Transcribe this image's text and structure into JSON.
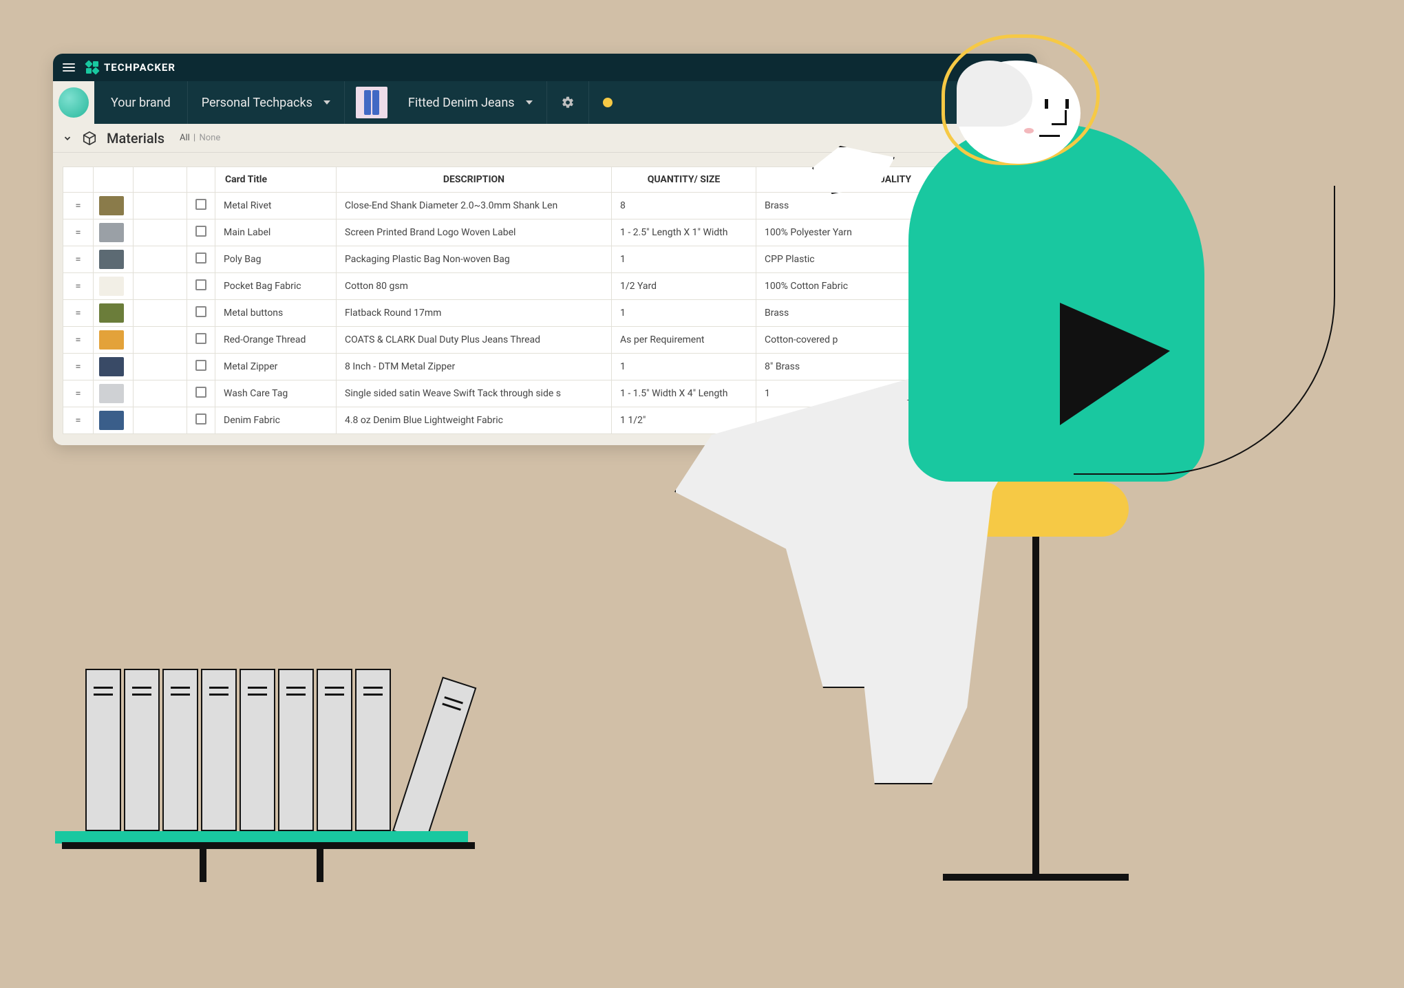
{
  "app": {
    "name": "TECHPACKER"
  },
  "nav": {
    "brand": "Your brand",
    "techpacks_dropdown": "Personal Techpacks",
    "product_dropdown": "Fitted Denim Jeans"
  },
  "section": {
    "title": "Materials",
    "filter_all": "All",
    "filter_none": "None"
  },
  "table": {
    "headers": {
      "card_title": "Card Title",
      "description": "DESCRIPTION",
      "quantity": "QUANTITY/ SIZE",
      "quality": "QUALITY"
    },
    "rows": [
      {
        "swatch": "#8a7b4a",
        "title": "Metal Rivet",
        "description": "Close-End  Shank Diameter 2.0~3.0mm Shank Len",
        "quantity": "8",
        "quality": "Brass"
      },
      {
        "swatch": "#9aa0a6",
        "title": "Main Label",
        "description": "Screen Printed Brand Logo Woven Label",
        "quantity": "1 - 2.5\" Length X 1\" Width",
        "quality": "100% Polyester Yarn"
      },
      {
        "swatch": "#5c6a73",
        "title": "Poly Bag",
        "description": "Packaging Plastic Bag Non-woven Bag",
        "quantity": "1",
        "quality": "CPP Plastic"
      },
      {
        "swatch": "#f2efe6",
        "title": "Pocket Bag Fabric",
        "description": "Cotton 80 gsm",
        "quantity": "1/2 Yard",
        "quality": "100% Cotton Fabric"
      },
      {
        "swatch": "#6b7d3a",
        "title": "Metal buttons",
        "description": "Flatback Round 17mm",
        "quantity": "1",
        "quality": "Brass"
      },
      {
        "swatch": "#e3a23a",
        "title": "Red-Orange Thread",
        "description": "COATS & CLARK Dual Duty Plus Jeans Thread",
        "quantity": "As per Requirement",
        "quality": "Cotton-covered p"
      },
      {
        "swatch": "#394a66",
        "title": "Metal Zipper",
        "description": " 8 Inch - DTM Metal Zipper",
        "quantity": "1",
        "quality": "8\" Brass"
      },
      {
        "swatch": "#cfd1d4",
        "title": "Wash Care Tag",
        "description": "Single sided satin Weave Swift Tack through side s",
        "quantity": "1 - 1.5\" Width X 4\" Length",
        "quality": "1"
      },
      {
        "swatch": "#3a5e8a",
        "title": "Denim Fabric",
        "description": "4.8 oz Denim Blue Lightweight Fabric",
        "quantity": "1 1/2\"",
        "quality": ""
      }
    ]
  }
}
